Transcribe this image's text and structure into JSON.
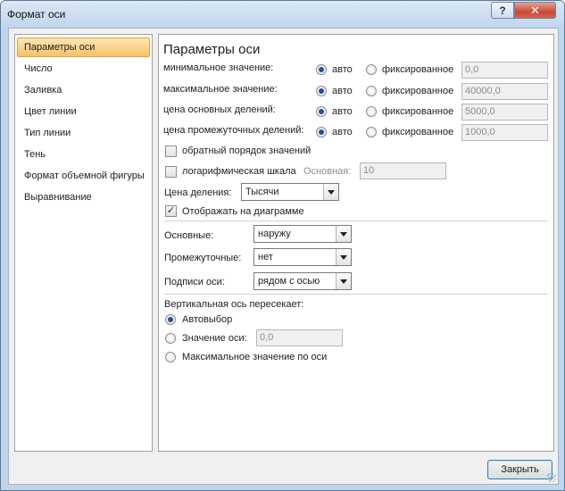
{
  "window": {
    "title": "Формат оси",
    "help_label": "?",
    "close_label": "✕"
  },
  "nav": {
    "items": [
      {
        "label": "Параметры оси",
        "selected": true
      },
      {
        "label": "Число"
      },
      {
        "label": "Заливка"
      },
      {
        "label": "Цвет линии"
      },
      {
        "label": "Тип линии"
      },
      {
        "label": "Тень"
      },
      {
        "label": "Формат объемной фигуры"
      },
      {
        "label": "Выравнивание"
      }
    ]
  },
  "panel": {
    "heading": "Параметры оси",
    "rows": [
      {
        "label": "минимальное значение:",
        "auto": "авто",
        "fixed": "фиксированное",
        "value": "0,0"
      },
      {
        "label": "максимальное значение:",
        "auto": "авто",
        "fixed": "фиксированное",
        "value": "40000,0"
      },
      {
        "label": "цена основных делений:",
        "auto": "авто",
        "fixed": "фиксированное",
        "value": "5000,0"
      },
      {
        "label": "цена промежуточных делений:",
        "auto": "авто",
        "fixed": "фиксированное",
        "value": "1000,0"
      }
    ],
    "reverse_order": {
      "label": "обратный порядок значений",
      "checked": false
    },
    "log_scale": {
      "label": "логарифмическая шкала",
      "base_label": "Основная:",
      "base_value": "10",
      "checked": false
    },
    "display_units": {
      "label": "Цена деления:",
      "value": "Тысячи"
    },
    "show_on_chart": {
      "label": "Отображать на диаграмме",
      "checked": true,
      "check_glyph": "✓"
    },
    "major_tick": {
      "label": "Основные:",
      "value": "наружу"
    },
    "minor_tick": {
      "label": "Промежуточные:",
      "value": "нет"
    },
    "axis_labels": {
      "label": "Подписи оси:",
      "value": "рядом с осью"
    },
    "crosses": {
      "label": "Вертикальная ось пересекает:",
      "auto": "Автовыбор",
      "value_label": "Значение оси:",
      "value": "0,0",
      "max_label": "Максимальное значение по оси"
    }
  },
  "footer": {
    "close_label": "Закрыть"
  },
  "colors": {
    "accent": "#f6c265",
    "radio_dot": "#1f4fa0",
    "frame": "#bfd5ec"
  }
}
